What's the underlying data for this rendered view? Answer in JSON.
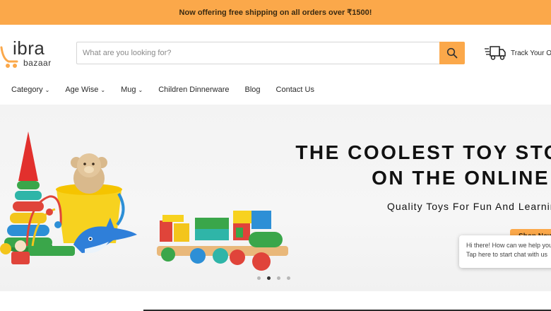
{
  "announcement": {
    "text": "Now offering free shipping on all orders over ₹1500!"
  },
  "logo": {
    "main": "ibra",
    "sub": "bazaar"
  },
  "search": {
    "placeholder": "What are you looking for?",
    "value": ""
  },
  "track": {
    "label": "Track Your Order"
  },
  "nav": {
    "items": [
      {
        "label": "Category",
        "has_dropdown": true
      },
      {
        "label": "Age Wise",
        "has_dropdown": true
      },
      {
        "label": "Mug",
        "has_dropdown": true
      },
      {
        "label": "Children Dinnerware",
        "has_dropdown": false
      },
      {
        "label": "Blog",
        "has_dropdown": false
      },
      {
        "label": "Contact Us",
        "has_dropdown": false
      }
    ]
  },
  "hero": {
    "title_line1": "THE COOLEST TOY STORE",
    "title_line2": "ON THE ONLINE",
    "subtitle": "Quality Toys For Fun And Learning",
    "button": "Shop Now",
    "slides_total": 4,
    "slide_active": 2
  },
  "chat": {
    "line1": "Hi there! How can we help you?",
    "line2": "Tap here to start chat with us"
  },
  "colors": {
    "accent": "#fba84a",
    "text": "#2a2a2a"
  },
  "icons": {
    "search": "search-icon",
    "truck": "truck-icon",
    "chevron": "chevron-down-icon",
    "cart": "cart-icon"
  }
}
